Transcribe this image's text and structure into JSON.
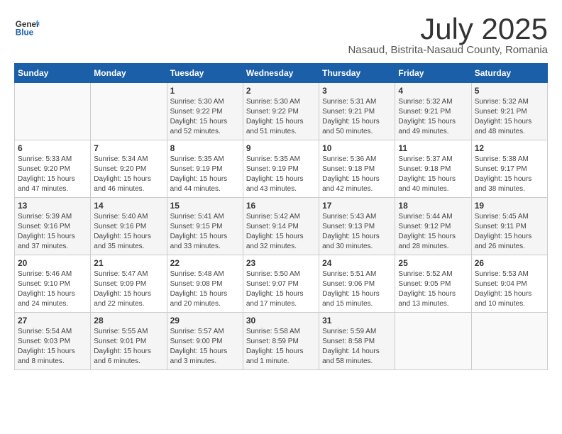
{
  "header": {
    "logo_general": "General",
    "logo_blue": "Blue",
    "month": "July 2025",
    "location": "Nasaud, Bistrita-Nasaud County, Romania"
  },
  "weekdays": [
    "Sunday",
    "Monday",
    "Tuesday",
    "Wednesday",
    "Thursday",
    "Friday",
    "Saturday"
  ],
  "weeks": [
    [
      {
        "day": "",
        "info": ""
      },
      {
        "day": "",
        "info": ""
      },
      {
        "day": "1",
        "info": "Sunrise: 5:30 AM\nSunset: 9:22 PM\nDaylight: 15 hours\nand 52 minutes."
      },
      {
        "day": "2",
        "info": "Sunrise: 5:30 AM\nSunset: 9:22 PM\nDaylight: 15 hours\nand 51 minutes."
      },
      {
        "day": "3",
        "info": "Sunrise: 5:31 AM\nSunset: 9:21 PM\nDaylight: 15 hours\nand 50 minutes."
      },
      {
        "day": "4",
        "info": "Sunrise: 5:32 AM\nSunset: 9:21 PM\nDaylight: 15 hours\nand 49 minutes."
      },
      {
        "day": "5",
        "info": "Sunrise: 5:32 AM\nSunset: 9:21 PM\nDaylight: 15 hours\nand 48 minutes."
      }
    ],
    [
      {
        "day": "6",
        "info": "Sunrise: 5:33 AM\nSunset: 9:20 PM\nDaylight: 15 hours\nand 47 minutes."
      },
      {
        "day": "7",
        "info": "Sunrise: 5:34 AM\nSunset: 9:20 PM\nDaylight: 15 hours\nand 46 minutes."
      },
      {
        "day": "8",
        "info": "Sunrise: 5:35 AM\nSunset: 9:19 PM\nDaylight: 15 hours\nand 44 minutes."
      },
      {
        "day": "9",
        "info": "Sunrise: 5:35 AM\nSunset: 9:19 PM\nDaylight: 15 hours\nand 43 minutes."
      },
      {
        "day": "10",
        "info": "Sunrise: 5:36 AM\nSunset: 9:18 PM\nDaylight: 15 hours\nand 42 minutes."
      },
      {
        "day": "11",
        "info": "Sunrise: 5:37 AM\nSunset: 9:18 PM\nDaylight: 15 hours\nand 40 minutes."
      },
      {
        "day": "12",
        "info": "Sunrise: 5:38 AM\nSunset: 9:17 PM\nDaylight: 15 hours\nand 38 minutes."
      }
    ],
    [
      {
        "day": "13",
        "info": "Sunrise: 5:39 AM\nSunset: 9:16 PM\nDaylight: 15 hours\nand 37 minutes."
      },
      {
        "day": "14",
        "info": "Sunrise: 5:40 AM\nSunset: 9:16 PM\nDaylight: 15 hours\nand 35 minutes."
      },
      {
        "day": "15",
        "info": "Sunrise: 5:41 AM\nSunset: 9:15 PM\nDaylight: 15 hours\nand 33 minutes."
      },
      {
        "day": "16",
        "info": "Sunrise: 5:42 AM\nSunset: 9:14 PM\nDaylight: 15 hours\nand 32 minutes."
      },
      {
        "day": "17",
        "info": "Sunrise: 5:43 AM\nSunset: 9:13 PM\nDaylight: 15 hours\nand 30 minutes."
      },
      {
        "day": "18",
        "info": "Sunrise: 5:44 AM\nSunset: 9:12 PM\nDaylight: 15 hours\nand 28 minutes."
      },
      {
        "day": "19",
        "info": "Sunrise: 5:45 AM\nSunset: 9:11 PM\nDaylight: 15 hours\nand 26 minutes."
      }
    ],
    [
      {
        "day": "20",
        "info": "Sunrise: 5:46 AM\nSunset: 9:10 PM\nDaylight: 15 hours\nand 24 minutes."
      },
      {
        "day": "21",
        "info": "Sunrise: 5:47 AM\nSunset: 9:09 PM\nDaylight: 15 hours\nand 22 minutes."
      },
      {
        "day": "22",
        "info": "Sunrise: 5:48 AM\nSunset: 9:08 PM\nDaylight: 15 hours\nand 20 minutes."
      },
      {
        "day": "23",
        "info": "Sunrise: 5:50 AM\nSunset: 9:07 PM\nDaylight: 15 hours\nand 17 minutes."
      },
      {
        "day": "24",
        "info": "Sunrise: 5:51 AM\nSunset: 9:06 PM\nDaylight: 15 hours\nand 15 minutes."
      },
      {
        "day": "25",
        "info": "Sunrise: 5:52 AM\nSunset: 9:05 PM\nDaylight: 15 hours\nand 13 minutes."
      },
      {
        "day": "26",
        "info": "Sunrise: 5:53 AM\nSunset: 9:04 PM\nDaylight: 15 hours\nand 10 minutes."
      }
    ],
    [
      {
        "day": "27",
        "info": "Sunrise: 5:54 AM\nSunset: 9:03 PM\nDaylight: 15 hours\nand 8 minutes."
      },
      {
        "day": "28",
        "info": "Sunrise: 5:55 AM\nSunset: 9:01 PM\nDaylight: 15 hours\nand 6 minutes."
      },
      {
        "day": "29",
        "info": "Sunrise: 5:57 AM\nSunset: 9:00 PM\nDaylight: 15 hours\nand 3 minutes."
      },
      {
        "day": "30",
        "info": "Sunrise: 5:58 AM\nSunset: 8:59 PM\nDaylight: 15 hours\nand 1 minute."
      },
      {
        "day": "31",
        "info": "Sunrise: 5:59 AM\nSunset: 8:58 PM\nDaylight: 14 hours\nand 58 minutes."
      },
      {
        "day": "",
        "info": ""
      },
      {
        "day": "",
        "info": ""
      }
    ]
  ]
}
